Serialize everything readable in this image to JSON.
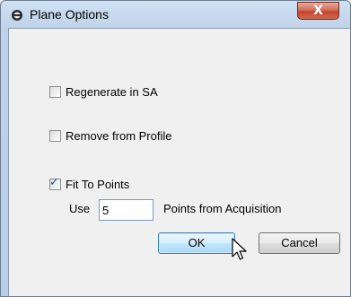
{
  "window": {
    "title": "Plane Options",
    "close_glyph": "X"
  },
  "options": {
    "regenerate": {
      "label": "Regenerate in SA",
      "checked": false
    },
    "remove": {
      "label": "Remove from Profile",
      "checked": false
    },
    "fit": {
      "label": "Fit To Points",
      "checked": true
    }
  },
  "points": {
    "prefix": "Use",
    "value": "5",
    "suffix": "Points from Acquisition"
  },
  "buttons": {
    "ok": "OK",
    "cancel": "Cancel"
  },
  "icons": {
    "title": "plane-options-app-icon",
    "check": "checkmark-icon",
    "cursor": "mouse-pointer-icon"
  }
}
